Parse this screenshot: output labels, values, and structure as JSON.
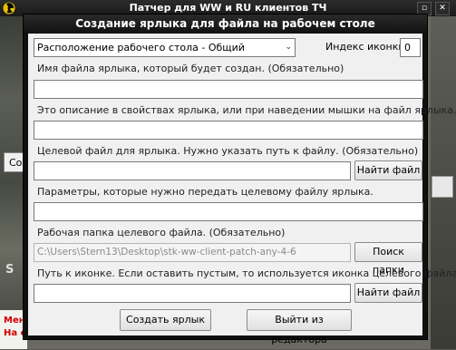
{
  "background": {
    "title": "Патчер для WW и RU клиентов ТЧ",
    "left_label": "Со",
    "left_s": "S",
    "status_lines": [
      "Мен",
      "На с"
    ]
  },
  "dialog": {
    "title": "Создание ярлыка для файла на рабочем столе",
    "location_select": "Расположение рабочего стола - Общий",
    "icon_index_label": "Индекс иконки",
    "icon_index_value": "0",
    "shortcut_name_label": "Имя файла ярлыка, который будет создан. (Обязательно)",
    "shortcut_name_value": "",
    "description_label": "Это описание в свойствах ярлыка, или при наведении мышки на файл ярлыка.",
    "description_value": "",
    "target_label": "Целевой файл для ярлыка. Нужно указать путь к файлу. (Обязательно)",
    "target_value": "",
    "find_file_button": "Найти файл",
    "params_label": "Параметры, которые нужно передать целевому файлу ярлыка.",
    "params_value": "",
    "workdir_label": "Рабочая папка целевого файла. (Обязательно)",
    "workdir_value": "C:\\Users\\Stern13\\Desktop\\stk-ww-client-patch-any-4-6",
    "find_folder_button": "Поиск папки",
    "icon_path_label": "Путь к иконке. Если оставить пустым, то используется иконка целевого файла.",
    "icon_path_value": "",
    "find_icon_button": "Найти файл",
    "create_button": "Создать ярлык",
    "exit_button": "Выйти из редактора"
  }
}
